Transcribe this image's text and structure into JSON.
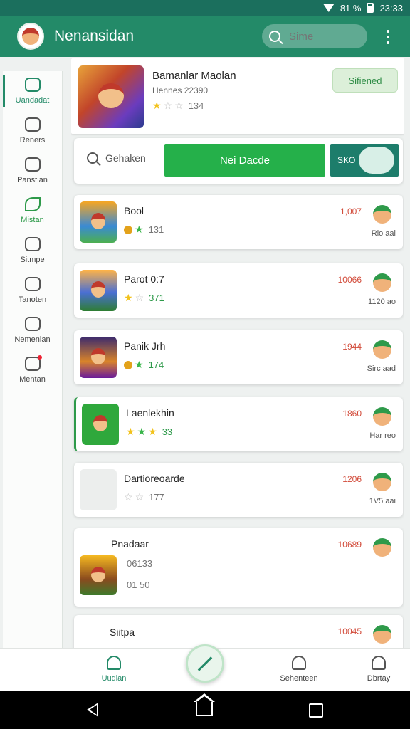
{
  "status_bar": {
    "signal": "81 %",
    "time": "23:33"
  },
  "app_bar": {
    "title": "Nenansidan",
    "search_placeholder": "Sime"
  },
  "sidebar": {
    "items": [
      {
        "label": "Uandadat",
        "icon": "wallet-icon"
      },
      {
        "label": "Reners",
        "icon": "home-icon"
      },
      {
        "label": "Panstian",
        "icon": "person-icon"
      },
      {
        "label": "Mistan",
        "icon": "leaf-icon"
      },
      {
        "label": "Sitmpe",
        "icon": "circle-icon"
      },
      {
        "label": "Tanoten",
        "icon": "edit-icon"
      },
      {
        "label": "Nemenian",
        "icon": "pen-icon"
      },
      {
        "label": "Mentan",
        "icon": "inbox-icon"
      }
    ]
  },
  "featured": {
    "title": "Bamanlar Maolan",
    "subtitle": "Hennes 22390",
    "rating_value": "134",
    "button": "Sifiened"
  },
  "toolbar": {
    "search_label": "Gehaken",
    "primary_button": "Nei Dacde",
    "toggle_label": "SKO"
  },
  "games": [
    {
      "title": "Bool",
      "rating": "131",
      "count": "1,007",
      "meta": "Rio aai"
    },
    {
      "title": "Parot 0:7",
      "rating": "371",
      "count": "10066",
      "meta": "1120 ao"
    },
    {
      "title": "Panik Jrh",
      "rating": "174",
      "count": "1944",
      "meta": "Sirc aad"
    },
    {
      "title": "Laenlekhin",
      "rating": "33",
      "count": "1860",
      "meta": "Har reo"
    },
    {
      "title": "Dartioreoarde",
      "rating": "177",
      "count": "1206",
      "meta": "1V5 aai"
    },
    {
      "title": "Pnadaar",
      "rating": "06133",
      "count": "10689",
      "meta": "",
      "extra": "01 50"
    },
    {
      "title": "Siitpa",
      "rating": "",
      "count": "10045",
      "meta": ""
    }
  ],
  "bottom_nav": {
    "items": [
      {
        "label": "Uudian",
        "icon": "home-user-icon"
      },
      {
        "label": "Sehenteen",
        "icon": "inbox-icon"
      },
      {
        "label": "Dbrtay",
        "icon": "profile-icon"
      }
    ]
  },
  "colors": {
    "primary": "#238a68",
    "accent_green": "#25b04a",
    "count_red": "#d24b3a"
  }
}
